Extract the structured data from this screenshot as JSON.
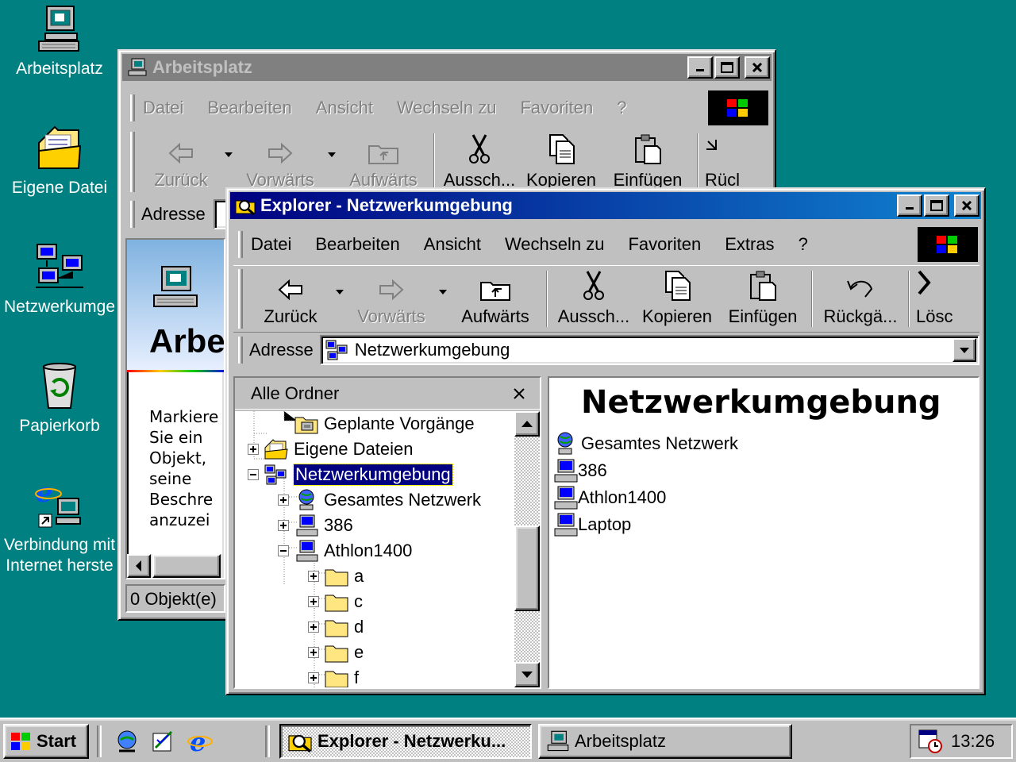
{
  "desktop": {
    "icons": [
      {
        "label": "Arbeitsplatz",
        "icon": "my-computer-icon"
      },
      {
        "label": "Eigene Datei",
        "icon": "my-documents-icon"
      },
      {
        "label": "Netzwerkumge",
        "icon": "network-neighborhood-icon"
      },
      {
        "label": "Papierkorb",
        "icon": "recycle-bin-icon"
      },
      {
        "label": "Verbindung mit",
        "label2": "Internet herste",
        "icon": "internet-connection-icon"
      }
    ]
  },
  "back_window": {
    "title": "Arbeitsplatz",
    "menu": [
      "Datei",
      "Bearbeiten",
      "Ansicht",
      "Wechseln zu",
      "Favoriten",
      "?"
    ],
    "toolbar": {
      "back": "Zurück",
      "forward": "Vorwärts",
      "up": "Aufwärts",
      "cut": "Aussch...",
      "copy": "Kopieren",
      "paste": "Einfügen",
      "undo": "Rücl"
    },
    "address_label": "Adresse",
    "banner_title": "Arbe",
    "description": [
      "Markiere",
      "Sie ein",
      "Objekt,",
      "seine",
      "Beschre",
      "anzuzei"
    ],
    "status": "0 Objekt(e)"
  },
  "front_window": {
    "title": "Explorer - Netzwerkumgebung",
    "menu": [
      "Datei",
      "Bearbeiten",
      "Ansicht",
      "Wechseln zu",
      "Favoriten",
      "Extras",
      "?"
    ],
    "toolbar": {
      "back": "Zurück",
      "forward": "Vorwärts",
      "up": "Aufwärts",
      "cut": "Aussch...",
      "copy": "Kopieren",
      "paste": "Einfügen",
      "undo": "Rückgä...",
      "delete": "Lösc"
    },
    "address_label": "Adresse",
    "address_value": "Netzwerkumgebung",
    "pane_title": "Alle Ordner",
    "tree": [
      {
        "label": "Geplante Vorgänge",
        "expander": "none",
        "icon": "scheduled-tasks-icon"
      },
      {
        "label": "Eigene Dateien",
        "expander": "plus",
        "icon": "my-documents-icon"
      },
      {
        "label": "Netzwerkumgebung",
        "expander": "minus",
        "icon": "network-neighborhood-icon",
        "selected": true
      },
      {
        "label": "Gesamtes Netzwerk",
        "expander": "plus",
        "icon": "entire-network-icon"
      },
      {
        "label": "386",
        "expander": "plus",
        "icon": "computer-icon"
      },
      {
        "label": "Athlon1400",
        "expander": "minus",
        "icon": "computer-icon"
      },
      {
        "label": "a",
        "expander": "plus",
        "icon": "folder-icon"
      },
      {
        "label": "c",
        "expander": "plus",
        "icon": "folder-icon"
      },
      {
        "label": "d",
        "expander": "plus",
        "icon": "folder-icon"
      },
      {
        "label": "e",
        "expander": "plus",
        "icon": "folder-icon"
      },
      {
        "label": "f",
        "expander": "plus",
        "icon": "folder-icon"
      }
    ],
    "content_title": "Netzwerkumgebung",
    "items": [
      {
        "label": "Gesamtes Netzwerk",
        "icon": "entire-network-icon"
      },
      {
        "label": "386",
        "icon": "computer-icon"
      },
      {
        "label": "Athlon1400",
        "icon": "computer-icon"
      },
      {
        "label": "Laptop",
        "icon": "computer-icon"
      }
    ]
  },
  "taskbar": {
    "start": "Start",
    "tasks": [
      {
        "label": "Explorer - Netzwerku...",
        "active": true
      },
      {
        "label": "Arbeitsplatz",
        "active": false
      }
    ],
    "clock": "13:26"
  },
  "colors": {
    "desktop": "#008080",
    "active_title": "#000080",
    "inactive_title": "#808080",
    "face": "#c0c0c0"
  }
}
